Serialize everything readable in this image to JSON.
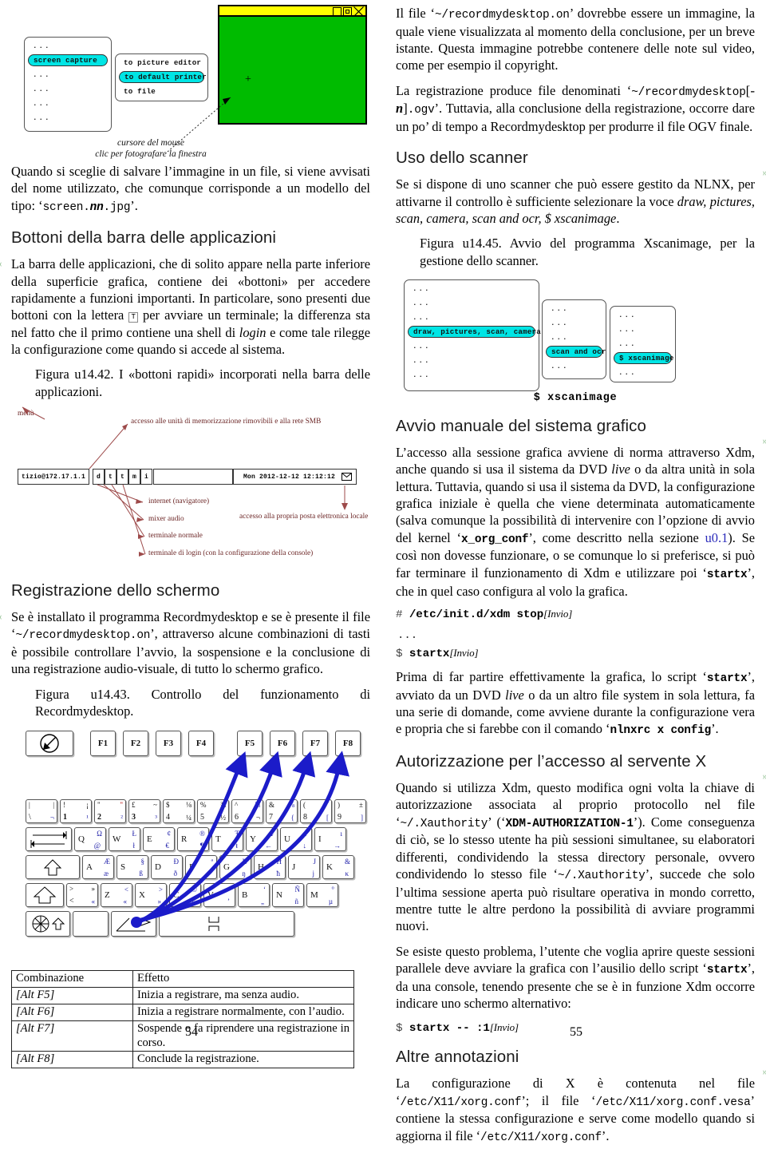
{
  "meta": {
    "page_left": "54",
    "page_right": "55"
  },
  "fig_capture": {
    "menu1": [
      "...",
      "screen capture",
      "...",
      "...",
      "...",
      "..."
    ],
    "menu1_selected": "screen capture",
    "menu2": [
      "to picture editor",
      "to default printer",
      "to file"
    ],
    "menu2_selected": "to default printer",
    "note_line1": "cursore del mouse",
    "note_line2": "clic per fotografare la finestra",
    "colors": {
      "titlebar": "#ffff00",
      "client": "#00bb00",
      "highlight": "#00e5e5"
    }
  },
  "left": {
    "p_screenshot": "Quando si sceglie di salvare l’immagine in un file, si viene avvisati del nome utilizzato, che comunque corrisponde a un modello del tipo: ‘screen.nn.jpg’.",
    "p_screenshot_parts": {
      "a": "Quando si sceglie di salvare l’immagine in un file, si viene avvisati del nome utilizzato, che comunque corrisponde a un modello del tipo: ‘",
      "code1": "screen.",
      "code_nn": "nn",
      "code2": ".jpg",
      "b": "’."
    },
    "h_bottoni": "Bottoni della barra delle applicazioni",
    "p_bottoni_a": "La barra delle applicazioni, che di solito appare nella parte inferiore della superficie grafica, contiene dei «bottoni» per accedere rapidamente a funzioni importanti. In particolare, sono presenti due bottoni con la lettera ",
    "p_bottoni_key": "T",
    "p_bottoni_b": " per avviare un terminale; la differenza sta nel fatto che il primo contiene una shell di ",
    "p_bottoni_login": "login",
    "p_bottoni_c": " e come tale rilegge la configurazione come quando si accede al sistema.",
    "fig_4442_caption": "Figura u14.42. I «bottoni rapidi» incorporati nella barra delle applicazioni.",
    "h_registrazione": "Registrazione dello schermo",
    "p_reg_a": "Se è installato il programma Recordmydesktop e se è presente il file ‘",
    "p_reg_code": "~/recordmydesktop.on",
    "p_reg_b": "’, attraverso alcune combinazioni di tasti è possibile controllare l’avvio, la sospensione e la conclusione di una registrazione audio-visuale, di tutto lo schermo grafico.",
    "fig_4443_caption": "Figura u14.43. Controllo del funzionamento di Recordmydesktop."
  },
  "fig_taskbar": {
    "labels": {
      "menu": "menù",
      "storage": "accesso alle unità di memorizzazione rimovibili e alla rete SMB",
      "internet": "internet (navigatore)",
      "mixer": "mixer audio",
      "term_normal": "terminale normale",
      "term_login": "terminale di login (con la configurazione della console)",
      "mail": "accesso alla propria posta elettronica locale"
    },
    "user_host": "tizio@172.17.1.1",
    "keys": [
      "d",
      "t",
      "t",
      "m",
      "i"
    ],
    "clock": "Mon 2012-12-12 12:12:12",
    "mail_icon": "envelope-icon"
  },
  "keyboard": {
    "fkeys": [
      "F1",
      "F2",
      "F3",
      "F4",
      "F5",
      "F6",
      "F7",
      "F8"
    ],
    "esc": "esc-icon",
    "numrow": [
      {
        "tl": "|",
        "tr": "|",
        "main": "\\",
        "br": "¬"
      },
      {
        "tl": "!",
        "tr": "¡",
        "main": "1",
        "br": "¹"
      },
      {
        "tl": "\"",
        "tr": "\"",
        "main": "2",
        "br": "²"
      },
      {
        "tl": "£",
        "tr": "~",
        "main": "3",
        "br": "³"
      },
      {
        "tl": "$",
        "tr": "⅛",
        "main": "4",
        "br": "¼"
      },
      {
        "tl": "%",
        "tr": "⅜",
        "main": "5",
        "br": "½"
      },
      {
        "tl": "^",
        "tr": "⅝",
        "main": "6",
        "br": "¬"
      },
      {
        "tl": "&",
        "tr": "⅞",
        "main": "7",
        "br": "{"
      },
      {
        "tl": "(",
        "tr": "ˇ",
        "main": "8",
        "br": "["
      },
      {
        "tl": ")",
        "tr": "±",
        "main": "9",
        "br": "]"
      }
    ],
    "row_q": [
      "Q Ω @",
      "W Ł ł",
      "E ¢ €",
      "R ® ¶",
      "T Ŧ ŧ",
      "Y ¥ ←",
      "U ↑ ↓",
      "I ı →"
    ],
    "row_a": [
      "A Æ æ",
      "S § ß",
      "D Ð ð",
      "F ª",
      "G Ŋ ŋ",
      "H Ħ ħ",
      "J J j",
      "K & κ"
    ],
    "row_z": [
      "> » < «",
      "Z < «",
      "X > »",
      "C © ¢",
      "V ‘ ’",
      "B ‘ „",
      "N Ñ ñ",
      "M ° µ"
    ],
    "alt_label": "alt-key"
  },
  "combo_table": {
    "headers": [
      "Combinazione",
      "Effetto"
    ],
    "rows": [
      [
        "[Alt F5]",
        "Inizia a registrare, ma senza audio."
      ],
      [
        "[Alt F6]",
        "Inizia a registrare normalmente, con l’audio."
      ],
      [
        "[Alt F7]",
        "Sospende o fa riprendere una registrazione in corso."
      ],
      [
        "[Alt F8]",
        "Conclude la registrazione."
      ]
    ]
  },
  "right": {
    "p1_a": "Il file ‘",
    "p1_code": "~/recordmydesktop.on",
    "p1_b": "’ dovrebbe essere un immagine, la quale viene visualizzata al momento della conclusione, per un breve istante. Questa immagine potrebbe contenere delle note sul video, come per esempio il copyright.",
    "p2_a": "La registrazione produce file denominati ‘",
    "p2_code1": "~/recordmydesktop",
    "p2_brk1": "[-",
    "p2_n": "n",
    "p2_brk2": "]",
    "p2_code2": ".ogv",
    "p2_b": "’. Tuttavia, alla conclusione della registrazione, occorre dare un po’ di tempo a Recordmydesktop per produrre il file OGV finale.",
    "h_scanner": "Uso dello scanner",
    "p_scanner_a": "Se si dispone di uno scanner che può essere gestito da NLNX, per attivarne il controllo è sufficiente selezionare la voce ",
    "p_scanner_it": "draw, pictures, scan, camera, scan and ocr, $ xscanimage",
    "p_scanner_b": ".",
    "fig_4445_caption": "Figura u14.45. Avvio del programma Xscanimage, per la gestione dello scanner.",
    "h_avvio": "Avvio manuale del sistema grafico",
    "p_avvio_a": "L’accesso alla sessione grafica avviene di norma attraverso Xdm, anche quando si usa il sistema da DVD ",
    "p_avvio_live": "live",
    "p_avvio_b": " o da altra unità in sola lettura. Tuttavia, quando si usa il sistema da DVD, la configurazione grafica iniziale è quella che viene determinata automaticamente (salva comunque la possibilità di intervenire con l’opzione di avvio del kernel ‘",
    "p_avvio_code1": "x_org_conf",
    "p_avvio_c": "’, come descritto nella sezione ",
    "p_avvio_link": "u0.1",
    "p_avvio_d": "). Se così non dovesse funzionare, o se comunque lo si preferisce, si può far terminare il funzionamento di Xdm e utilizzare poi ‘",
    "p_avvio_code2": "startx",
    "p_avvio_e": "’, che in quel caso configura al volo la grafica.",
    "cmd1_prompt": "#",
    "cmd1": "/etc/init.d/xdm stop",
    "cmd1_key": "[Invio]",
    "cmd_dots": "...",
    "cmd2_prompt": "$",
    "cmd2": "startx",
    "cmd2_key": "[Invio]",
    "p_prima_a": "Prima di far partire effettivamente la grafica, lo script ‘",
    "p_prima_code1": "startx",
    "p_prima_b": "’, avviato da un DVD ",
    "p_prima_live": "live",
    "p_prima_c": " o da un altro file system in sola lettura, fa una serie di domande, come avviene durante la configurazione vera e propria che si farebbe con il comando ‘",
    "p_prima_code2": "nlnxrc x config",
    "p_prima_d": "’.",
    "h_autorizzazione": "Autorizzazione per l’accesso al servente X",
    "p_auth_a": "Quando si utilizza Xdm, questo modifica ogni volta la chiave di autorizzazione associata al proprio protocollo nel file ‘",
    "p_auth_code1": "~/.Xauthority",
    "p_auth_b": "’ (‘",
    "p_auth_code2": "XDM-AUTHORIZATION-1",
    "p_auth_c": "’). Come conseguenza di ciò, se lo stesso utente ha più sessioni simultanee, su elaboratori differenti, condividendo la stessa directory personale, ovvero condividendo lo stesso file ‘",
    "p_auth_code3": "~/.Xauthority",
    "p_auth_d": "’, succede che solo l’ultima sessione aperta può risultare operativa in mondo corretto, mentre tutte le altre perdono la possibilità di avviare programmi nuovi.",
    "p_se_a": "Se esiste questo problema, l’utente che voglia aprire queste sessioni parallele deve avviare la grafica con l’ausilio dello script ‘",
    "p_se_code": "startx",
    "p_se_b": "’, da una console, tenendo presente che se è in funzione Xdm occorre indicare uno schermo alternativo:",
    "cmd3_prompt": "$",
    "cmd3": "startx -- :1",
    "cmd3_key": "[Invio]",
    "h_altre": "Altre annotazioni",
    "p_altre_a": "La configurazione di X è contenuta nel file ‘",
    "p_altre_code1": "/etc/X11/xorg.conf",
    "p_altre_b": "’; il file ‘",
    "p_altre_code2": "/etc/X11/xorg.conf.vesa",
    "p_altre_c": "’ contiene la stessa configurazione e serve come modello quando si aggiorna il file ‘",
    "p_altre_code3": "/etc/X11/xorg.conf",
    "p_altre_d": "’."
  },
  "fig_scan": {
    "menu1": [
      "...",
      "...",
      "...",
      "draw, pictures, scan, camera",
      "...",
      "...",
      "..."
    ],
    "menu1_selected": "draw, pictures, scan, camera",
    "menu2": [
      "...",
      "...",
      "...",
      "scan and ocr",
      "..."
    ],
    "menu2_selected": "scan and ocr",
    "menu3": [
      "...",
      "...",
      "...",
      "$ xscanimage",
      "..."
    ],
    "menu3_selected": "$ xscanimage",
    "caption": "$ xscanimage"
  }
}
